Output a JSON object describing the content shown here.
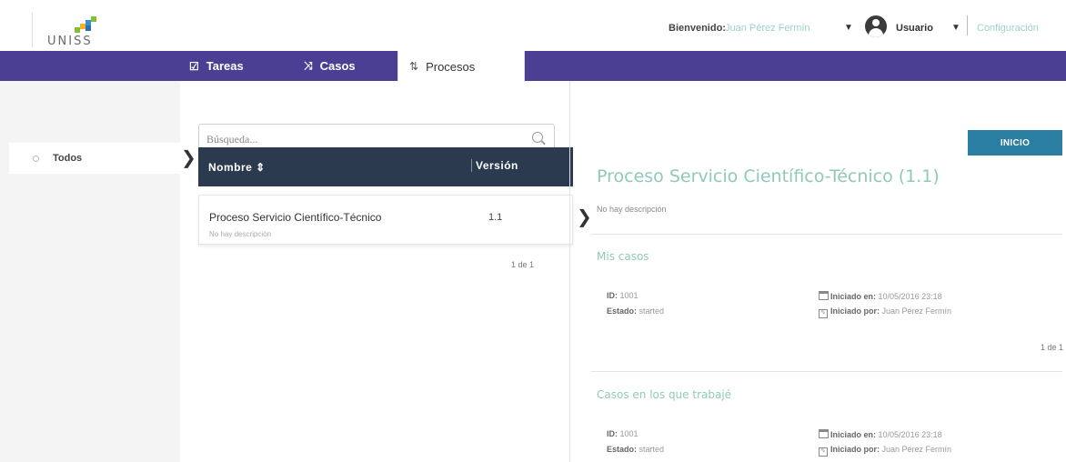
{
  "header": {
    "logo_text": "UNISS",
    "welcome_label": "Bienvenido:",
    "welcome_name": "Juan Pérez Fermín",
    "user_label": "Usuario",
    "config_label": "Configuración"
  },
  "nav": {
    "tabs": [
      {
        "label": "Tareas",
        "icon": "edit-icon"
      },
      {
        "label": "Casos",
        "icon": "shuffle-icon"
      },
      {
        "label": "Procesos",
        "icon": "process-icon",
        "active": true
      }
    ],
    "color": "#4a3f93"
  },
  "sidebar": {
    "items": [
      {
        "label": "Todos"
      }
    ]
  },
  "list": {
    "search_placeholder": "Búsqueda...",
    "col_name": "Nombre ⇕",
    "col_version": "Versión",
    "rows": [
      {
        "name": "Proceso Servicio Científico-Técnico",
        "desc": "No hay descripción",
        "version": "1.1"
      }
    ],
    "pager": "1 de 1"
  },
  "detail": {
    "start_button": "INICIO",
    "title": "Proceso Servicio Científico-Técnico (1.1)",
    "description": "No hay descripción",
    "my_cases": {
      "title": "Mis casos",
      "id_label": "ID:",
      "id_value": "1001",
      "state_label": "Estado:",
      "state_value": "started",
      "started_on_label": "Iniciado en:",
      "started_on_value": "10/05/2016 23:18",
      "started_by_label": "Iniciado por:",
      "started_by_value": "Juan Pérez Fermín",
      "pager": "1 de 1"
    },
    "worked_cases": {
      "title": "Casos en los que trabajé",
      "id_label": "ID:",
      "id_value": "1001",
      "state_label": "Estado:",
      "state_value": "started",
      "started_on_label": "Iniciado en:",
      "started_on_value": "10/05/2016 23:18",
      "started_by_label": "Iniciado por:",
      "started_by_value": "Juan Pérez Fermín"
    },
    "accent_color": "#8fcab9",
    "button_color": "#2a7ea1"
  }
}
